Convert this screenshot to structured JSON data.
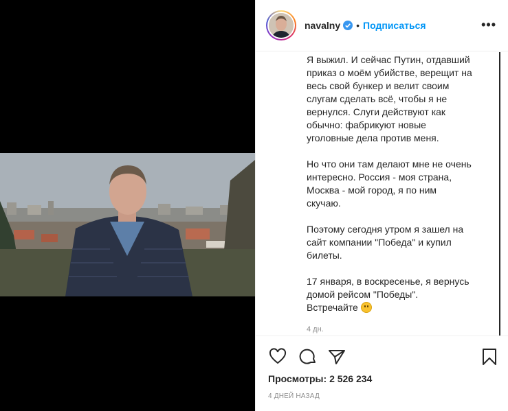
{
  "post": {
    "username": "navalny",
    "follow_label": "Подписаться",
    "separator": "•",
    "more_label": "•••",
    "caption": "Я выжил. И сейчас Путин, отдавший\nприказ о моём убийстве, верещит на\nвесь свой бункер и велит своим\nслугам сделать всё, чтобы я не\nвернулся. Слуги действуют как\nобычно: фабрикуют новые\nуголовные дела против меня.\n\nНо что они там делают мне не очень\nинтересно. Россия - моя страна,\nМосква - мой город, я по ним\nскучаю.\n\nПоэтому сегодня утром я зашел на\nсайт компании \"Победа\" и купил\nбилеты.\n\n17 января, в воскресенье, я вернусь\nдомой рейсом \"Победы\".\nВстречайте",
    "caption_emoji": "smiling-face-emoji",
    "caption_time": "4 дн.",
    "views_label": "Просмотры:",
    "views_count": "2 526 234",
    "date": "4 дней назад"
  },
  "icons": {
    "verified": "verified-badge-icon",
    "like": "heart-icon",
    "comment": "comment-icon",
    "share": "paper-plane-icon",
    "save": "bookmark-icon"
  },
  "colors": {
    "accent": "#0095f6",
    "text": "#262626",
    "muted": "#8e8e8e"
  }
}
